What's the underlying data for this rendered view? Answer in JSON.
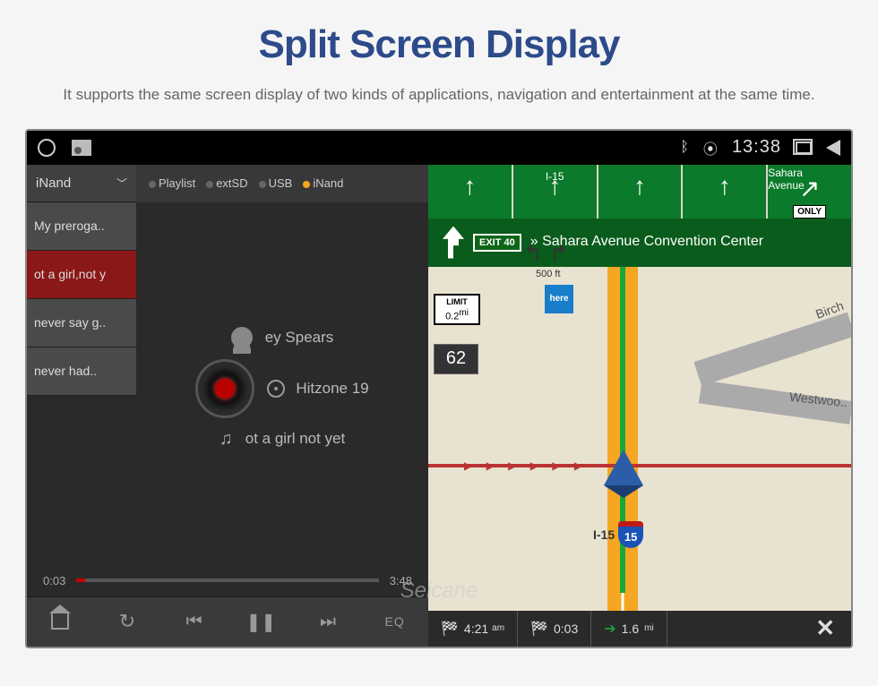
{
  "header": {
    "title": "Split Screen Display",
    "subtitle": "It supports the same screen display of two kinds of applications, navigation and entertainment at the same time."
  },
  "statusbar": {
    "time": "13:38"
  },
  "music": {
    "source_selected": "iNand",
    "tabs": [
      "Playlist",
      "extSD",
      "USB",
      "iNand"
    ],
    "active_tab_index": 3,
    "playlist": [
      {
        "label": "My preroga..",
        "selected": false
      },
      {
        "label": "ot a girl,not y",
        "selected": true
      },
      {
        "label": "never say g..",
        "selected": false
      },
      {
        "label": "never had..",
        "selected": false
      }
    ],
    "now_playing": {
      "artist": "ey Spears",
      "album": "Hitzone 19",
      "track": "ot a girl not yet"
    },
    "progress": {
      "elapsed": "0:03",
      "total": "3:48"
    },
    "eq_label": "EQ"
  },
  "nav": {
    "highway": "I-15",
    "top_street": "Sahara Avenue",
    "only_label": "ONLY",
    "exit_badge": "EXIT 40",
    "direction": "» Sahara Avenue Convention Center",
    "limit_label": "LIMIT",
    "limit_dist": "0.2",
    "limit_unit": "mi",
    "speed": "62",
    "ft_label": "500 ft",
    "here_label": "here",
    "shield_label": "I-15",
    "shield_num": "15",
    "roads": {
      "birch": "Birch",
      "westwood": "Westwoo.."
    },
    "bottom": {
      "eta": "4:21",
      "eta_unit": "am",
      "remaining": "0:03",
      "dist": "1.6",
      "dist_unit": "mi"
    }
  },
  "watermark": "Seicane"
}
